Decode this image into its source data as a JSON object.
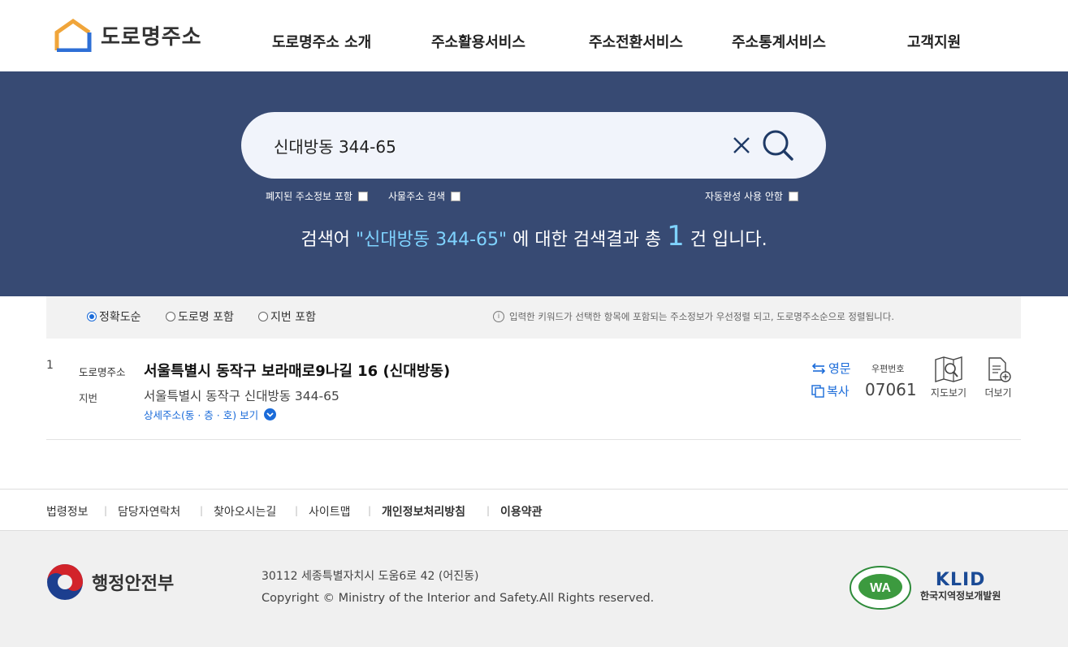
{
  "header": {
    "logo_text": "도로명주소",
    "nav": [
      "도로명주소 소개",
      "주소활용서비스",
      "주소전환서비스",
      "주소통계서비스",
      "고객지원"
    ]
  },
  "search": {
    "value": "신대방동 344-65",
    "options": {
      "abolished": "폐지된 주소정보 포함",
      "building": "사물주소 검색",
      "autocomplete_off": "자동완성 사용 안함"
    },
    "result": {
      "prefix": "검색어 ",
      "keyword": "\"신대방동 344-65\"",
      "middle": " 에 대한 검색결과 총 ",
      "count": "1",
      "suffix": " 건 입니다."
    }
  },
  "sort": {
    "options": [
      "정확도순",
      "도로명 포함",
      "지번 포함"
    ],
    "selected": "정확도순",
    "note": "입력한 키워드가 선택한 항목에 포함되는 주소정보가 우선정렬 되고, 도로명주소순으로 정렬됩니다."
  },
  "results": [
    {
      "num": "1",
      "road_label": "도로명주소",
      "road_address": "서울특별시 동작구 보라매로9나길 16 (신대방동)",
      "jibun_label": "지번",
      "jibun_address": "서울특별시 동작구 신대방동 344-65",
      "detail_link": "상세주소(동 · 층 · 호) 보기",
      "english_link": "영문",
      "copy_link": "복사",
      "zip_label": "우편번호",
      "zip_code": "07061",
      "map_label": "지도보기",
      "more_label": "더보기"
    }
  ],
  "footer": {
    "links": [
      "법령정보",
      "담당자연락처",
      "찾아오시는길",
      "사이트맵",
      "개인정보처리방침",
      "이용약관"
    ],
    "org": "행정안전부",
    "address": "30112 세종특별자치시 도움6로 42 (어진동)",
    "copyright": "Copyright © Ministry of the Interior and Safety.All Rights reserved.",
    "badge_text": "WA",
    "klid_logo": "KLID",
    "klid_name": "한국지역정보개발원"
  },
  "colors": {
    "band": "#374a73",
    "accent": "#1a6bd9",
    "highlight": "#7fd3ff"
  }
}
